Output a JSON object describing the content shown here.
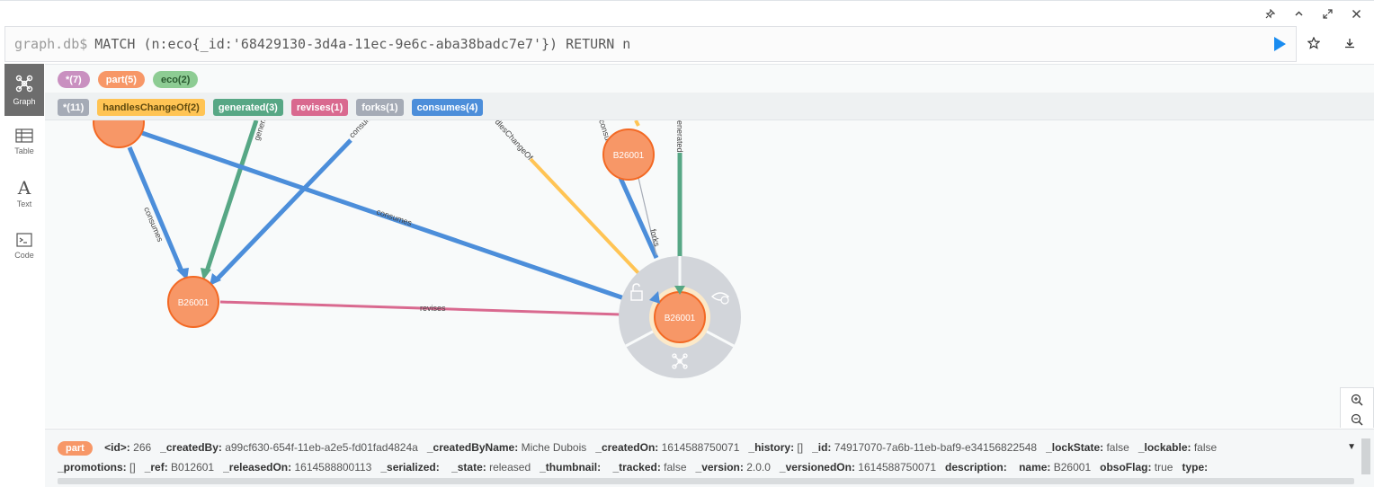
{
  "query": {
    "prompt": "graph.db$",
    "command": "MATCH (n:eco{_id:'68429130-3d4a-11ec-9e6c-aba38badc7e7'}) RETURN n"
  },
  "window_controls": [
    "pin-icon",
    "collapse-icon",
    "expand-icon",
    "close-icon"
  ],
  "sidebar": {
    "items": [
      {
        "label": "Graph",
        "icon": "graph-icon",
        "active": true
      },
      {
        "label": "Table",
        "icon": "table-icon",
        "active": false
      },
      {
        "label": "Text",
        "icon": "text-icon",
        "active": false
      },
      {
        "label": "Code",
        "icon": "code-icon",
        "active": false
      }
    ]
  },
  "legend": {
    "nodes": [
      {
        "label": "*(7)",
        "color": "#c990c0"
      },
      {
        "label": "part(5)",
        "color": "#f79767"
      },
      {
        "label": "eco(2)",
        "color": "#8dcc93"
      }
    ],
    "relationships": [
      {
        "label": "*(11)",
        "color": "#a5abb6"
      },
      {
        "label": "handlesChangeOf(2)",
        "color": "#ffc454"
      },
      {
        "label": "generated(3)",
        "color": "#57a785"
      },
      {
        "label": "revises(1)",
        "color": "#d9698f"
      },
      {
        "label": "forks(1)",
        "color": "#a5abb6"
      },
      {
        "label": "consumes(4)",
        "color": "#4c8eda"
      }
    ]
  },
  "graph": {
    "nodes": [
      {
        "label": "B26001"
      },
      {
        "label": "B26001"
      },
      {
        "label": "B26001"
      }
    ],
    "edge_labels": {
      "consumes_a": "consumes",
      "consumes_b": "consumes",
      "generated_a": "generat",
      "consumes_c": "consum",
      "handles": "dlesChangeOf",
      "consumes_d": "consum",
      "generated_b": "enerated",
      "forks": "forks",
      "revises": "revises"
    }
  },
  "properties": {
    "label": "part",
    "line1": [
      {
        "key": "<id>:",
        "value": "266"
      },
      {
        "key": "_createdBy:",
        "value": "a99cf630-654f-11eb-a2e5-fd01fad4824a"
      },
      {
        "key": "_createdByName:",
        "value": "Miche Dubois"
      },
      {
        "key": "_createdOn:",
        "value": "1614588750071"
      },
      {
        "key": "_history:",
        "value": "[]"
      },
      {
        "key": "_id:",
        "value": "74917070-7a6b-11eb-baf9-e34156822548"
      },
      {
        "key": "_lockState:",
        "value": "false"
      },
      {
        "key": "_lockable:",
        "value": "false"
      }
    ],
    "line2": [
      {
        "key": "_promotions:",
        "value": "[]"
      },
      {
        "key": "_ref:",
        "value": "B012601"
      },
      {
        "key": "_releasedOn:",
        "value": "1614588800113"
      },
      {
        "key": "_serialized:",
        "value": ""
      },
      {
        "key": "_state:",
        "value": "released"
      },
      {
        "key": "_thumbnail:",
        "value": ""
      },
      {
        "key": "_tracked:",
        "value": "false"
      },
      {
        "key": "_version:",
        "value": "2.0.0"
      },
      {
        "key": "_versionedOn:",
        "value": "1614588750071"
      },
      {
        "key": "description:",
        "value": ""
      },
      {
        "key": "name:",
        "value": "B26001"
      },
      {
        "key": "obsoFlag:",
        "value": "true"
      },
      {
        "key": "type:",
        "value": ""
      }
    ]
  }
}
